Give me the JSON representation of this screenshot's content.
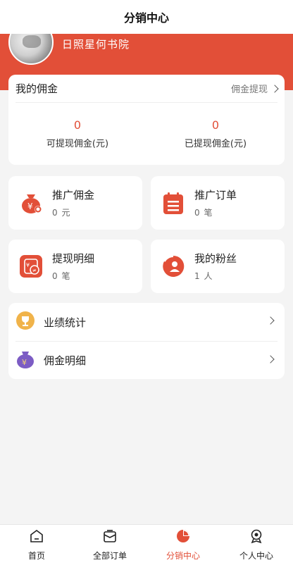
{
  "header": {
    "title": "分销中心"
  },
  "profile": {
    "shop_name": "日照星何书院"
  },
  "commission": {
    "title": "我的佣金",
    "withdraw_link": "佣金提现",
    "withdrawable_value": "0",
    "withdrawable_label": "可提现佣金(元)",
    "withdrawn_value": "0",
    "withdrawn_label": "已提现佣金(元)"
  },
  "tiles": [
    {
      "title": "推广佣金",
      "sub": "0 元",
      "icon": "money-bag-icon"
    },
    {
      "title": "推广订单",
      "sub": "0 笔",
      "icon": "clipboard-icon"
    },
    {
      "title": "提现明细",
      "sub": "0 笔",
      "icon": "exchange-icon"
    },
    {
      "title": "我的粉丝",
      "sub": "1 人",
      "icon": "user-icon"
    }
  ],
  "list": [
    {
      "label": "业绩统计",
      "icon": "trophy-icon"
    },
    {
      "label": "佣金明细",
      "icon": "money-bag-icon"
    }
  ],
  "tabbar": [
    {
      "label": "首页",
      "icon": "home-icon"
    },
    {
      "label": "全部订单",
      "icon": "order-box-icon"
    },
    {
      "label": "分销中心",
      "icon": "pie-chart-icon",
      "active": true
    },
    {
      "label": "个人中心",
      "icon": "profile-badge-icon"
    }
  ],
  "colors": {
    "accent": "#e24f38",
    "background": "#f4f4f4"
  }
}
